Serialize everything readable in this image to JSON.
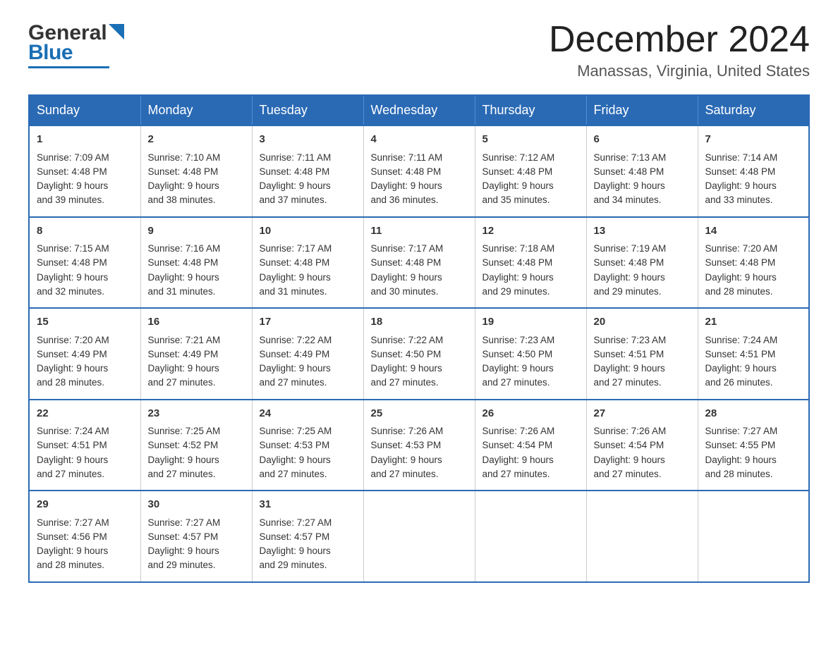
{
  "header": {
    "logo_text_black": "General",
    "logo_text_blue": "Blue",
    "month_title": "December 2024",
    "location": "Manassas, Virginia, United States"
  },
  "days_of_week": [
    "Sunday",
    "Monday",
    "Tuesday",
    "Wednesday",
    "Thursday",
    "Friday",
    "Saturday"
  ],
  "weeks": [
    [
      {
        "day": "1",
        "sunrise": "7:09 AM",
        "sunset": "4:48 PM",
        "daylight": "9 hours and 39 minutes."
      },
      {
        "day": "2",
        "sunrise": "7:10 AM",
        "sunset": "4:48 PM",
        "daylight": "9 hours and 38 minutes."
      },
      {
        "day": "3",
        "sunrise": "7:11 AM",
        "sunset": "4:48 PM",
        "daylight": "9 hours and 37 minutes."
      },
      {
        "day": "4",
        "sunrise": "7:11 AM",
        "sunset": "4:48 PM",
        "daylight": "9 hours and 36 minutes."
      },
      {
        "day": "5",
        "sunrise": "7:12 AM",
        "sunset": "4:48 PM",
        "daylight": "9 hours and 35 minutes."
      },
      {
        "day": "6",
        "sunrise": "7:13 AM",
        "sunset": "4:48 PM",
        "daylight": "9 hours and 34 minutes."
      },
      {
        "day": "7",
        "sunrise": "7:14 AM",
        "sunset": "4:48 PM",
        "daylight": "9 hours and 33 minutes."
      }
    ],
    [
      {
        "day": "8",
        "sunrise": "7:15 AM",
        "sunset": "4:48 PM",
        "daylight": "9 hours and 32 minutes."
      },
      {
        "day": "9",
        "sunrise": "7:16 AM",
        "sunset": "4:48 PM",
        "daylight": "9 hours and 31 minutes."
      },
      {
        "day": "10",
        "sunrise": "7:17 AM",
        "sunset": "4:48 PM",
        "daylight": "9 hours and 31 minutes."
      },
      {
        "day": "11",
        "sunrise": "7:17 AM",
        "sunset": "4:48 PM",
        "daylight": "9 hours and 30 minutes."
      },
      {
        "day": "12",
        "sunrise": "7:18 AM",
        "sunset": "4:48 PM",
        "daylight": "9 hours and 29 minutes."
      },
      {
        "day": "13",
        "sunrise": "7:19 AM",
        "sunset": "4:48 PM",
        "daylight": "9 hours and 29 minutes."
      },
      {
        "day": "14",
        "sunrise": "7:20 AM",
        "sunset": "4:48 PM",
        "daylight": "9 hours and 28 minutes."
      }
    ],
    [
      {
        "day": "15",
        "sunrise": "7:20 AM",
        "sunset": "4:49 PM",
        "daylight": "9 hours and 28 minutes."
      },
      {
        "day": "16",
        "sunrise": "7:21 AM",
        "sunset": "4:49 PM",
        "daylight": "9 hours and 27 minutes."
      },
      {
        "day": "17",
        "sunrise": "7:22 AM",
        "sunset": "4:49 PM",
        "daylight": "9 hours and 27 minutes."
      },
      {
        "day": "18",
        "sunrise": "7:22 AM",
        "sunset": "4:50 PM",
        "daylight": "9 hours and 27 minutes."
      },
      {
        "day": "19",
        "sunrise": "7:23 AM",
        "sunset": "4:50 PM",
        "daylight": "9 hours and 27 minutes."
      },
      {
        "day": "20",
        "sunrise": "7:23 AM",
        "sunset": "4:51 PM",
        "daylight": "9 hours and 27 minutes."
      },
      {
        "day": "21",
        "sunrise": "7:24 AM",
        "sunset": "4:51 PM",
        "daylight": "9 hours and 26 minutes."
      }
    ],
    [
      {
        "day": "22",
        "sunrise": "7:24 AM",
        "sunset": "4:51 PM",
        "daylight": "9 hours and 27 minutes."
      },
      {
        "day": "23",
        "sunrise": "7:25 AM",
        "sunset": "4:52 PM",
        "daylight": "9 hours and 27 minutes."
      },
      {
        "day": "24",
        "sunrise": "7:25 AM",
        "sunset": "4:53 PM",
        "daylight": "9 hours and 27 minutes."
      },
      {
        "day": "25",
        "sunrise": "7:26 AM",
        "sunset": "4:53 PM",
        "daylight": "9 hours and 27 minutes."
      },
      {
        "day": "26",
        "sunrise": "7:26 AM",
        "sunset": "4:54 PM",
        "daylight": "9 hours and 27 minutes."
      },
      {
        "day": "27",
        "sunrise": "7:26 AM",
        "sunset": "4:54 PM",
        "daylight": "9 hours and 27 minutes."
      },
      {
        "day": "28",
        "sunrise": "7:27 AM",
        "sunset": "4:55 PM",
        "daylight": "9 hours and 28 minutes."
      }
    ],
    [
      {
        "day": "29",
        "sunrise": "7:27 AM",
        "sunset": "4:56 PM",
        "daylight": "9 hours and 28 minutes."
      },
      {
        "day": "30",
        "sunrise": "7:27 AM",
        "sunset": "4:57 PM",
        "daylight": "9 hours and 29 minutes."
      },
      {
        "day": "31",
        "sunrise": "7:27 AM",
        "sunset": "4:57 PM",
        "daylight": "9 hours and 29 minutes."
      },
      null,
      null,
      null,
      null
    ]
  ],
  "labels": {
    "sunrise": "Sunrise:",
    "sunset": "Sunset:",
    "daylight": "Daylight:"
  }
}
